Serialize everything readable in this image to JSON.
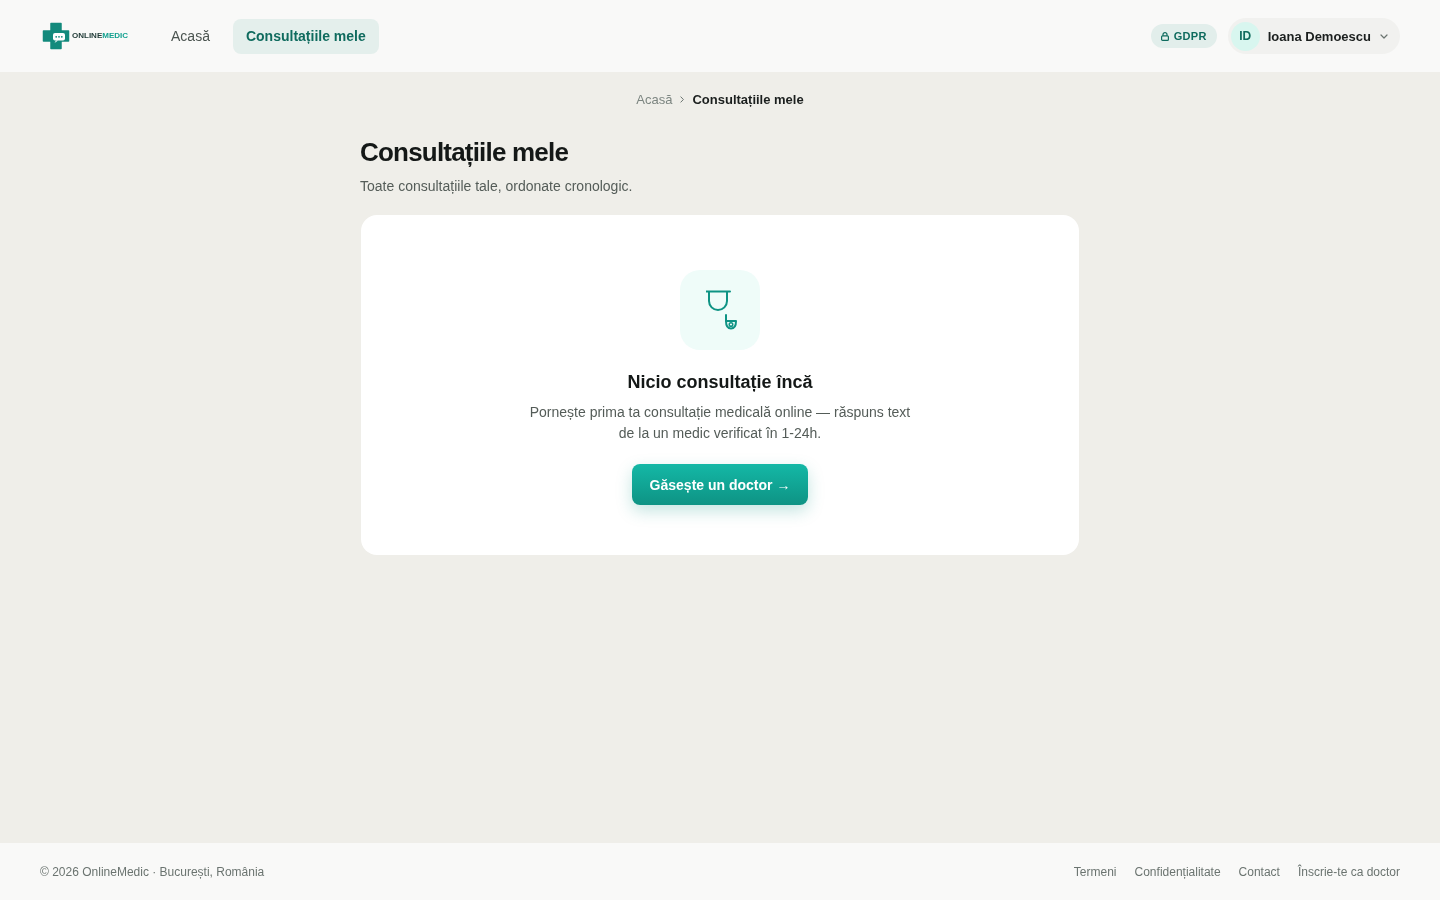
{
  "header": {
    "logo": {
      "parts": [
        "ONLINE",
        "MEDIC"
      ]
    },
    "nav": [
      {
        "label": "Acasă",
        "selected": false
      },
      {
        "label": "Consultațiile mele",
        "selected": true
      }
    ],
    "badge": {
      "label": "GDPR"
    },
    "user": {
      "initials": "ID",
      "name": "Ioana Demoescu"
    }
  },
  "breadcrumb": [
    {
      "label": "Acasă",
      "current": false
    },
    {
      "label": "Consultațiile mele",
      "current": true
    }
  ],
  "page": {
    "title": "Consultațiile mele",
    "subtitle": "Toate consultațiile tale, ordonate cronologic."
  },
  "empty_state": {
    "title": "Nicio consultație încă",
    "text": "Pornește prima ta consultație medicală online — răspuns text de la un medic verificat în 1-24h.",
    "button": "Găsește un doctor →"
  },
  "footer": {
    "copyright": "© 2026 OnlineMedic · București, România",
    "links": [
      "Termeni",
      "Confidențialitate",
      "Contact",
      "Înscrie-te ca doctor"
    ]
  }
}
